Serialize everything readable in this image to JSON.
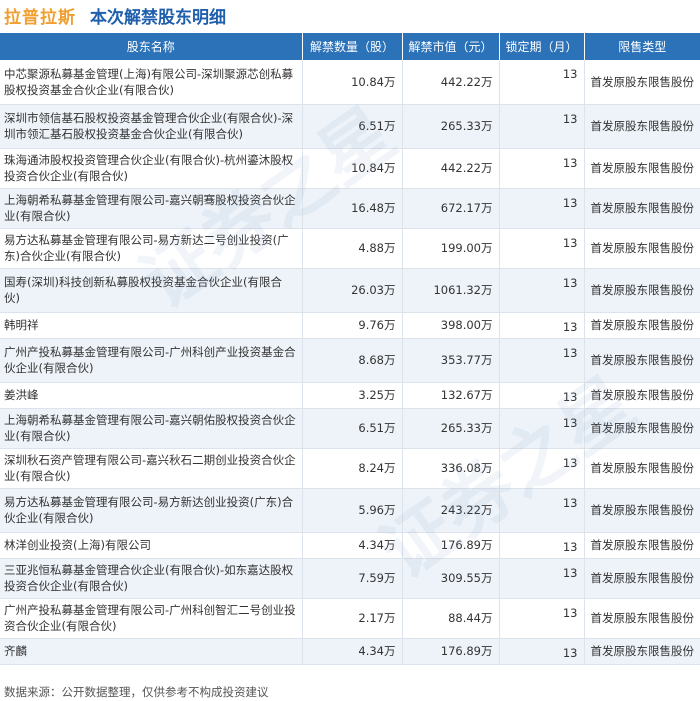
{
  "header": {
    "brand": "拉普拉斯",
    "title": "本次解禁股东明细"
  },
  "columns": [
    "股东名称",
    "解禁数量（股）",
    "解禁市值（元）",
    "锁定期（月）",
    "限售类型"
  ],
  "rows": [
    {
      "name": "中芯聚源私募基金管理(上海)有限公司-深圳聚源芯创私募股权投资基金合伙企业(有限合伙)",
      "qty": "10.84万",
      "value": "442.22万",
      "lock": "13",
      "type": "首发原股东限售股份"
    },
    {
      "name": "深圳市领信基石股权投资基金管理合伙企业(有限合伙)-深圳市领汇基石股权投资基金合伙企业(有限合伙)",
      "qty": "6.51万",
      "value": "265.33万",
      "lock": "13",
      "type": "首发原股东限售股份"
    },
    {
      "name": "珠海通沛股权投资管理合伙企业(有限合伙)-杭州鎏沐股权投资合伙企业(有限合伙)",
      "qty": "10.84万",
      "value": "442.22万",
      "lock": "13",
      "type": "首发原股东限售股份"
    },
    {
      "name": "上海朝希私募基金管理有限公司-嘉兴朝骞股权投资合伙企业(有限合伙)",
      "qty": "16.48万",
      "value": "672.17万",
      "lock": "13",
      "type": "首发原股东限售股份"
    },
    {
      "name": "易方达私募基金管理有限公司-易方新达二号创业投资(广东)合伙企业(有限合伙)",
      "qty": "4.88万",
      "value": "199.00万",
      "lock": "13",
      "type": "首发原股东限售股份"
    },
    {
      "name": "国寿(深圳)科技创新私募股权投资基金合伙企业(有限合伙)",
      "qty": "26.03万",
      "value": "1061.32万",
      "lock": "13",
      "type": "首发原股东限售股份"
    },
    {
      "name": "韩明祥",
      "qty": "9.76万",
      "value": "398.00万",
      "lock": "13",
      "type": "首发原股东限售股份"
    },
    {
      "name": "广州产投私募基金管理有限公司-广州科创产业投资基金合伙企业(有限合伙)",
      "qty": "8.68万",
      "value": "353.77万",
      "lock": "13",
      "type": "首发原股东限售股份"
    },
    {
      "name": "姜洪峰",
      "qty": "3.25万",
      "value": "132.67万",
      "lock": "13",
      "type": "首发原股东限售股份"
    },
    {
      "name": "上海朝希私募基金管理有限公司-嘉兴朝佑股权投资合伙企业(有限合伙)",
      "qty": "6.51万",
      "value": "265.33万",
      "lock": "13",
      "type": "首发原股东限售股份"
    },
    {
      "name": "深圳秋石资产管理有限公司-嘉兴秋石二期创业投资合伙企业(有限合伙)",
      "qty": "8.24万",
      "value": "336.08万",
      "lock": "13",
      "type": "首发原股东限售股份"
    },
    {
      "name": "易方达私募基金管理有限公司-易方新达创业投资(广东)合伙企业(有限合伙)",
      "qty": "5.96万",
      "value": "243.22万",
      "lock": "13",
      "type": "首发原股东限售股份"
    },
    {
      "name": "林洋创业投资(上海)有限公司",
      "qty": "4.34万",
      "value": "176.89万",
      "lock": "13",
      "type": "首发原股东限售股份"
    },
    {
      "name": "三亚兆恒私募基金管理合伙企业(有限合伙)-如东嘉达股权投资合伙企业(有限合伙)",
      "qty": "7.59万",
      "value": "309.55万",
      "lock": "13",
      "type": "首发原股东限售股份"
    },
    {
      "name": "广州产投私募基金管理有限公司-广州科创智汇二号创业投资合伙企业(有限合伙)",
      "qty": "2.17万",
      "value": "88.44万",
      "lock": "13",
      "type": "首发原股东限售股份"
    },
    {
      "name": "齐麟",
      "qty": "4.34万",
      "value": "176.89万",
      "lock": "13",
      "type": "首发原股东限售股份"
    }
  ],
  "footer": "数据来源：公开数据整理，仅供参考不构成投资建议",
  "watermark": "证券之星"
}
